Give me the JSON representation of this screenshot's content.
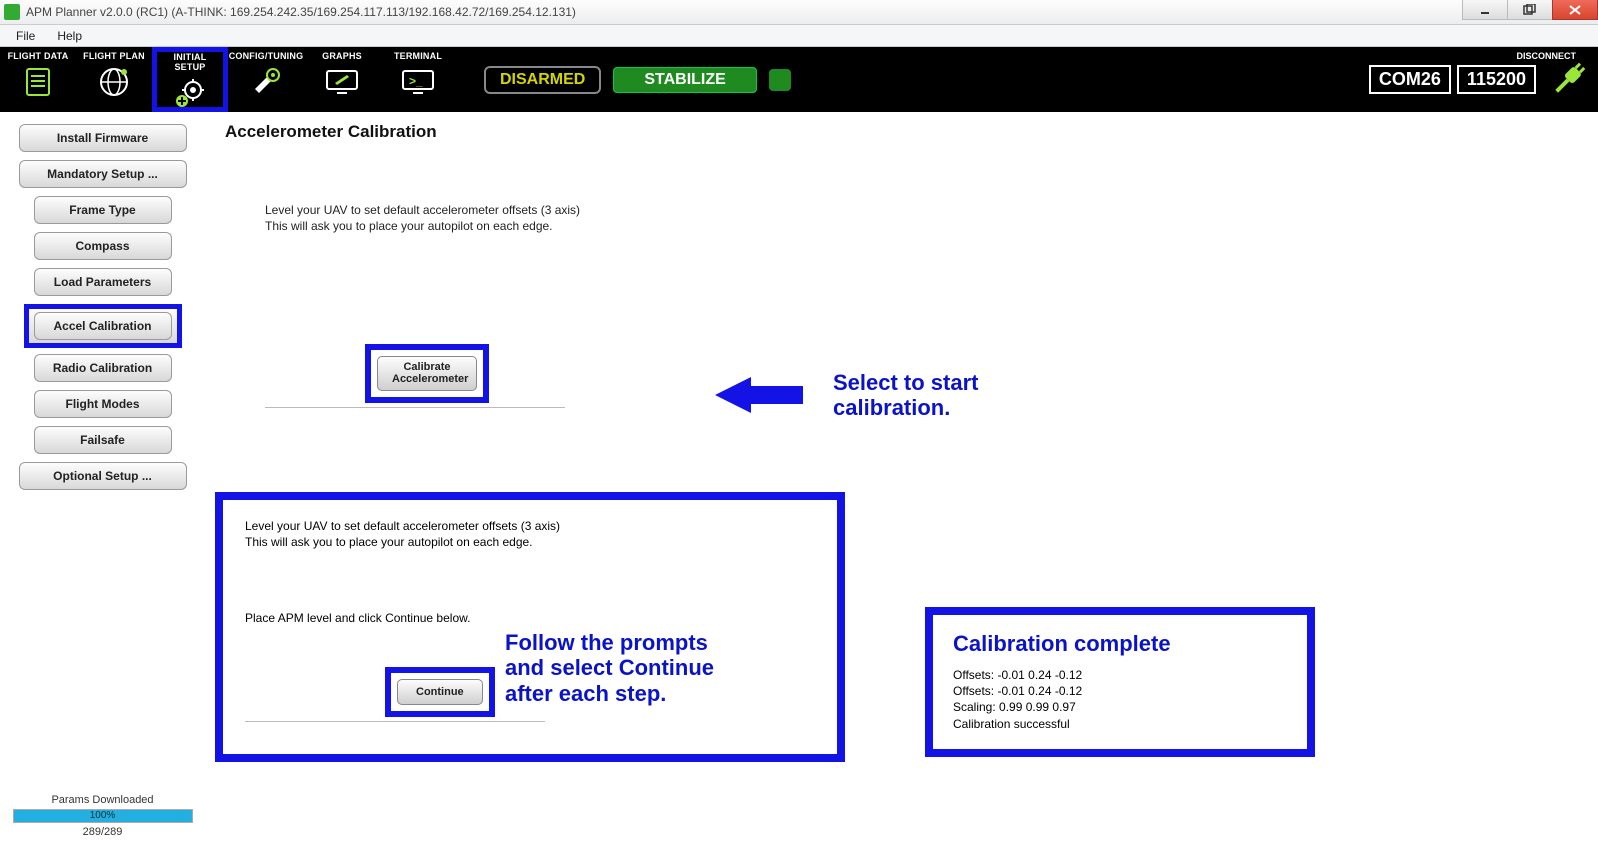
{
  "window": {
    "title": "APM Planner v2.0.0 (RC1) (A-THINK: 169.254.242.35/169.254.117.113/192.168.42.72/169.254.12.131)"
  },
  "menubar": {
    "file": "File",
    "help": "Help"
  },
  "toolbar": {
    "tabs": {
      "flight_data": "FLIGHT DATA",
      "flight_plan": "FLIGHT PLAN",
      "initial_setup": "INITIAL SETUP",
      "config_tuning": "CONFIG/TUNING",
      "graphs": "GRAPHS",
      "terminal": "TERMINAL"
    },
    "disarmed": "DISARMED",
    "mode": "STABILIZE",
    "com_port": "COM26",
    "baud": "115200",
    "disconnect": "DISCONNECT"
  },
  "sidebar": {
    "install_firmware": "Install Firmware",
    "mandatory_setup": "Mandatory Setup ...",
    "frame_type": "Frame Type",
    "compass": "Compass",
    "load_parameters": "Load Parameters",
    "accel_calibration": "Accel Calibration",
    "radio_calibration": "Radio Calibration",
    "flight_modes": "Flight Modes",
    "failsafe": "Failsafe",
    "optional_setup": "Optional Setup ...",
    "params_label": "Params Downloaded",
    "progress_pct": "100%",
    "params_count": "289/289"
  },
  "content": {
    "heading": "Accelerometer Calibration",
    "instr1a": "Level your UAV to set default accelerometer offsets (3 axis)",
    "instr1b": "This will ask you to place your autopilot on each edge.",
    "calibrate_btn_l1": "Calibrate",
    "calibrate_btn_l2": "Accelerometer",
    "annot1": "Select to start calibration.",
    "instr2a": "Level your UAV to set default accelerometer offsets (3 axis)",
    "instr2b": "This will ask you to place your autopilot on each edge.",
    "instr2c": "Place APM level and click Continue below.",
    "continue_btn": "Continue",
    "annot2": "Follow the prompts and select Continue after each step.",
    "complete_title": "Calibration complete",
    "complete_l1": "Offsets: -0.01 0.24 -0.12",
    "complete_l2": "Offsets: -0.01 0.24 -0.12",
    "complete_l3": "Scaling: 0.99 0.99 0.97",
    "complete_l4": "Calibration successful"
  }
}
